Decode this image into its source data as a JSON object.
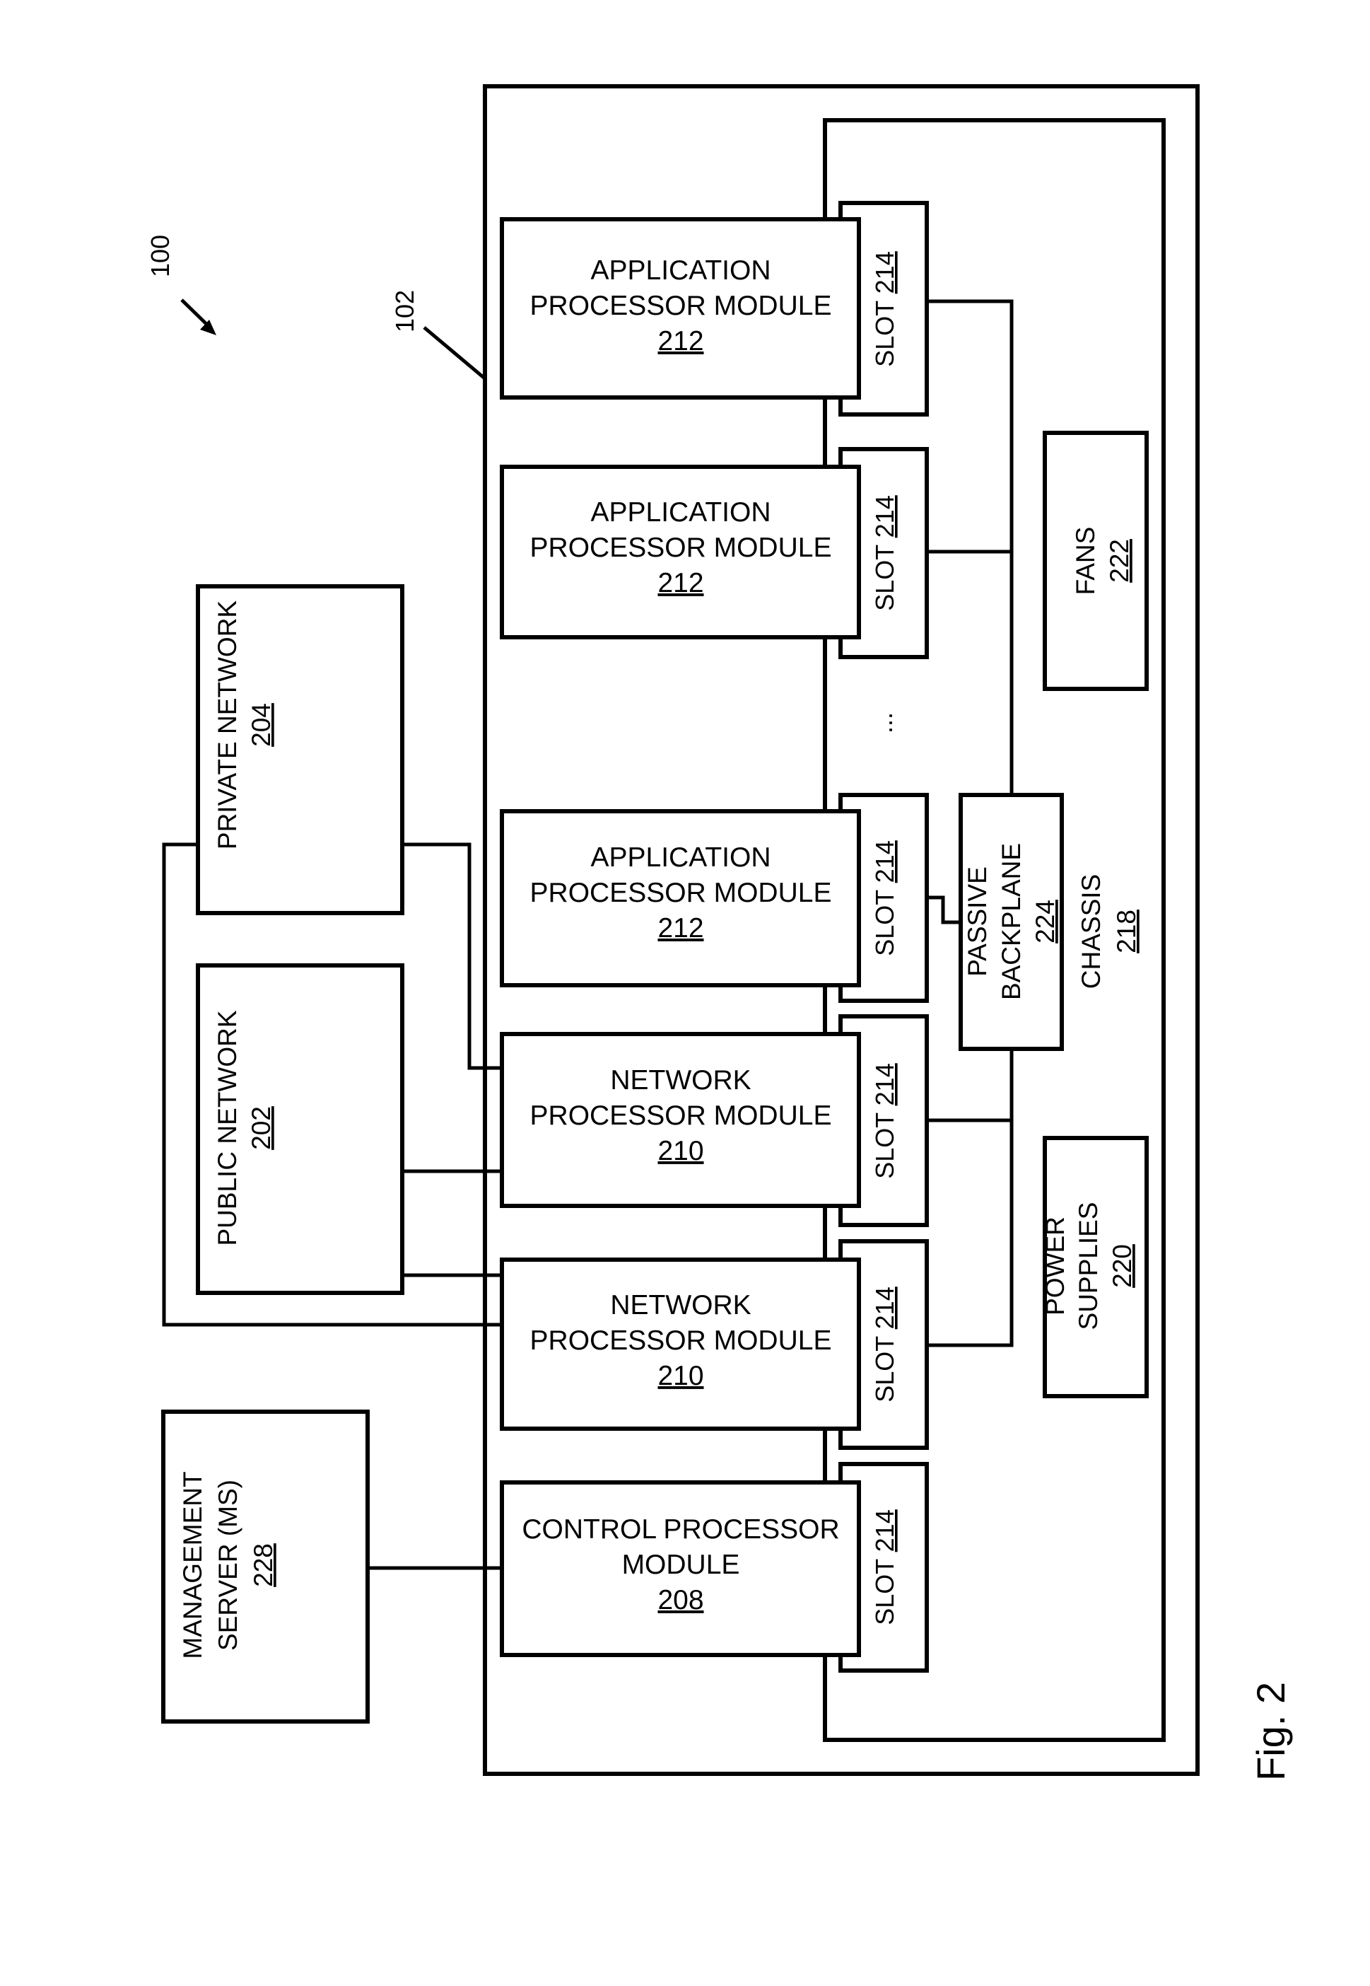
{
  "figure": {
    "label": "Fig. 2",
    "system_ref": "100",
    "enclosure_ref": "102"
  },
  "external": {
    "private_network": {
      "name": "PRIVATE NETWORK",
      "ref": "204"
    },
    "public_network": {
      "name": "PUBLIC NETWORK",
      "ref": "202"
    },
    "management_server": {
      "line1": "MANAGEMENT",
      "line2": "SERVER (MS)",
      "ref": "228"
    }
  },
  "modules": [
    {
      "line1": "APPLICATION",
      "line2": "PROCESSOR MODULE",
      "ref": "212"
    },
    {
      "line1": "APPLICATION",
      "line2": "PROCESSOR MODULE",
      "ref": "212"
    },
    {
      "line1": "APPLICATION",
      "line2": "PROCESSOR MODULE",
      "ref": "212"
    },
    {
      "line1": "NETWORK",
      "line2": "PROCESSOR MODULE",
      "ref": "210"
    },
    {
      "line1": "NETWORK",
      "line2": "PROCESSOR MODULE",
      "ref": "210"
    },
    {
      "line1": "CONTROL PROCESSOR",
      "line2": "MODULE",
      "ref": "208"
    }
  ],
  "slots": [
    {
      "name": "SLOT",
      "ref": "214"
    },
    {
      "name": "SLOT",
      "ref": "214"
    },
    {
      "name": "SLOT",
      "ref": "214"
    },
    {
      "name": "SLOT",
      "ref": "214"
    },
    {
      "name": "SLOT",
      "ref": "214"
    },
    {
      "name": "SLOT",
      "ref": "214"
    }
  ],
  "ellipsis": "...",
  "chassis": {
    "name": "CHASSIS",
    "ref": "218"
  },
  "backplane": {
    "line1": "PASSIVE",
    "line2": "BACKPLANE",
    "ref": "224"
  },
  "fans": {
    "name": "FANS",
    "ref": "222"
  },
  "power_supplies": {
    "line1": "POWER",
    "line2": "SUPPLIES",
    "ref": "220"
  }
}
